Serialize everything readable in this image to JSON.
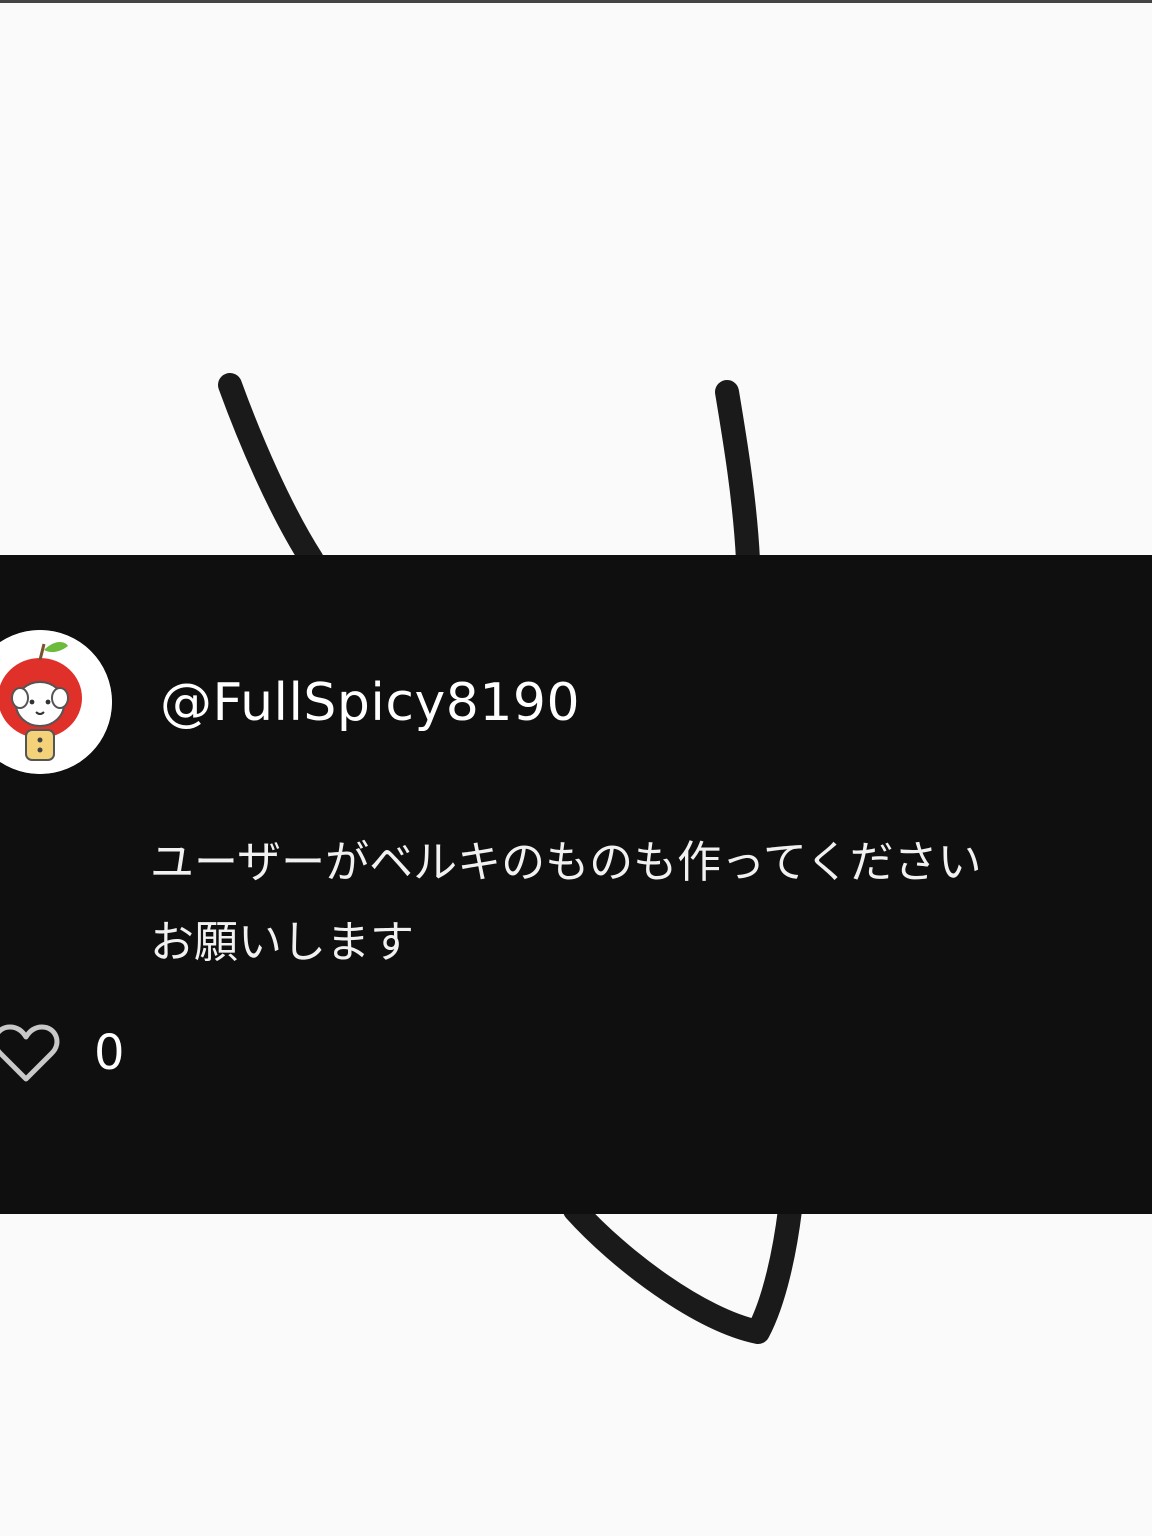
{
  "comment": {
    "username": "@FullSpicy8190",
    "text_lines": [
      "ユーザーがベルキのものも作ってください",
      "お願いします"
    ],
    "like_count": "0",
    "avatar_icon": "apple-sheep-avatar-icon",
    "like_icon": "heart-outline-icon"
  },
  "colors": {
    "background": "#fafafa",
    "card": "#0f0f0f",
    "text": "#ffffff",
    "scribble": "#1a1a1a"
  }
}
